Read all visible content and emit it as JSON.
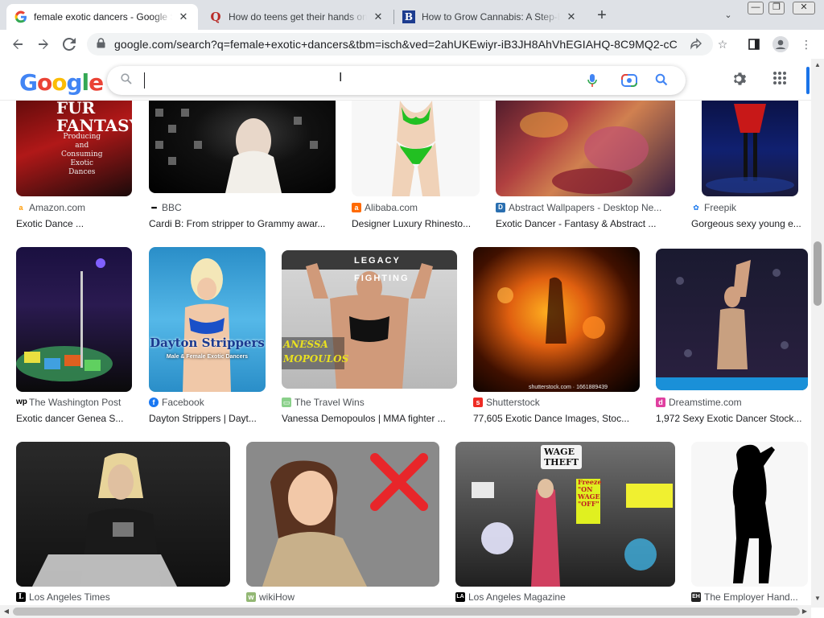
{
  "browser": {
    "tabs": [
      {
        "title": "female exotic dancers - Google S",
        "favicon": "google-icon",
        "active": true
      },
      {
        "title": "How do teens get their hands on",
        "favicon": "quora-icon",
        "active": false
      },
      {
        "title": "How to Grow Cannabis: A Step-B",
        "favicon": "business-insider-icon",
        "active": false
      }
    ],
    "new_tab_symbol": "+",
    "url": "google.com/search?q=female+exotic+dancers&tbm=isch&ved=2ahUKEwiyr-iB3JH8AhVhEGIAHQ-8C9MQ2-cCe..."
  },
  "google": {
    "logo_text": "Google",
    "logo_colors": [
      "#4285f4",
      "#ea4335",
      "#fbbc05",
      "#4285f4",
      "#34a853",
      "#ea4335"
    ],
    "search_value": ""
  },
  "results": [
    {
      "source": "Amazon.com",
      "source_icon": "amazon-icon",
      "title": "Exotic Dance ...",
      "thumb_text": "FUR\nFANTASY",
      "thumb_sub": "Producing\nand\nConsuming\nExotic\nDances"
    },
    {
      "source": "BBC",
      "source_icon": "bbc-icon",
      "title": "Cardi B: From stripper to Grammy awar..."
    },
    {
      "source": "Alibaba.com",
      "source_icon": "alibaba-icon",
      "title": "Designer Luxury Rhinesto..."
    },
    {
      "source": "Abstract Wallpapers - Desktop Ne...",
      "source_icon": "abstract-wallpapers-icon",
      "title": "Exotic Dancer - Fantasy & Abstract ..."
    },
    {
      "source": "Freepik",
      "source_icon": "freepik-icon",
      "title": "Gorgeous sexy young e..."
    },
    {
      "source": "The Washington Post",
      "source_icon": "washington-post-icon",
      "title": "Exotic dancer Genea S..."
    },
    {
      "source": "Facebook",
      "source_icon": "facebook-icon",
      "title": "Dayton Strippers | Dayt...",
      "thumb_text": "Dayton Strippers",
      "thumb_sub": "Male & Female Exotic Dancers"
    },
    {
      "source": "The Travel Wins",
      "source_icon": "travel-wins-icon",
      "title": "Vanessa Demopoulos | MMA fighter ...",
      "thumb_text": "LEGACY FIGHTING",
      "thumb_sub": "ANESSA\nMOPOULOS"
    },
    {
      "source": "Shutterstock",
      "source_icon": "shutterstock-icon",
      "title": "77,605 Exotic Dance Images, Stoc...",
      "thumb_stamp": "shutterstock.com · 1661889439"
    },
    {
      "source": "Dreamstime.com",
      "source_icon": "dreamstime-icon",
      "title": "1,972 Sexy Exotic Dancer Stock..."
    },
    {
      "source": "Los Angeles Times",
      "source_icon": "la-times-icon",
      "title": ""
    },
    {
      "source": "wikiHow",
      "source_icon": "wikihow-icon",
      "title": ""
    },
    {
      "source": "Los Angeles Magazine",
      "source_icon": "la-magazine-icon",
      "title": "",
      "thumb_text": "WAGE\nTHEFT",
      "thumb_sub": "Freeze\n\"ON\nWAGE\n\"OFF\""
    },
    {
      "source": "The Employer Hand...",
      "source_icon": "employer-handbook-icon",
      "title": ""
    }
  ]
}
